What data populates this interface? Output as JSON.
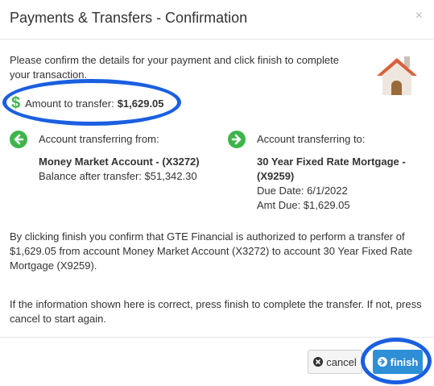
{
  "dialog": {
    "title": "Payments & Transfers - Confirmation",
    "close_symbol": "×"
  },
  "intro": {
    "line1": "Please confirm the details for your payment and click finish to complete",
    "line2": "your transaction."
  },
  "amount": {
    "icon": "dollar-icon",
    "label": "Amount to transfer:",
    "value": "$1,629.05"
  },
  "from": {
    "icon": "arrow-left-circle-icon",
    "header": "Account transferring from:",
    "name": "Money Market Account - (X3272)",
    "balance": "Balance after transfer: $51,342.30"
  },
  "to": {
    "icon": "arrow-right-circle-icon",
    "header": "Account transferring to:",
    "name_line1": "30 Year Fixed Rate Mortgage -",
    "name_line2": "(X9259)",
    "due_date": "Due Date: 6/1/2022",
    "amt_due": "Amt Due: $1,629.05"
  },
  "authorization_text": {
    "line1": "By clicking finish you confirm that GTE Financial is authorized to perform a transfer of",
    "line2": "$1,629.05 from account Money Market Account (X3272) to account 30 Year Fixed Rate",
    "line3": "Mortgage (X9259)."
  },
  "instruction_text": {
    "line1": "If the information shown here is correct, press finish to complete the transfer. If not, press",
    "line2": "cancel to start again."
  },
  "buttons": {
    "cancel": "cancel",
    "finish": "finish"
  },
  "colors": {
    "accent_green": "#3db54a",
    "finish_blue": "#2e8fd6",
    "highlight_blue": "#1a5fe0",
    "house_roof": "#d9603b"
  }
}
